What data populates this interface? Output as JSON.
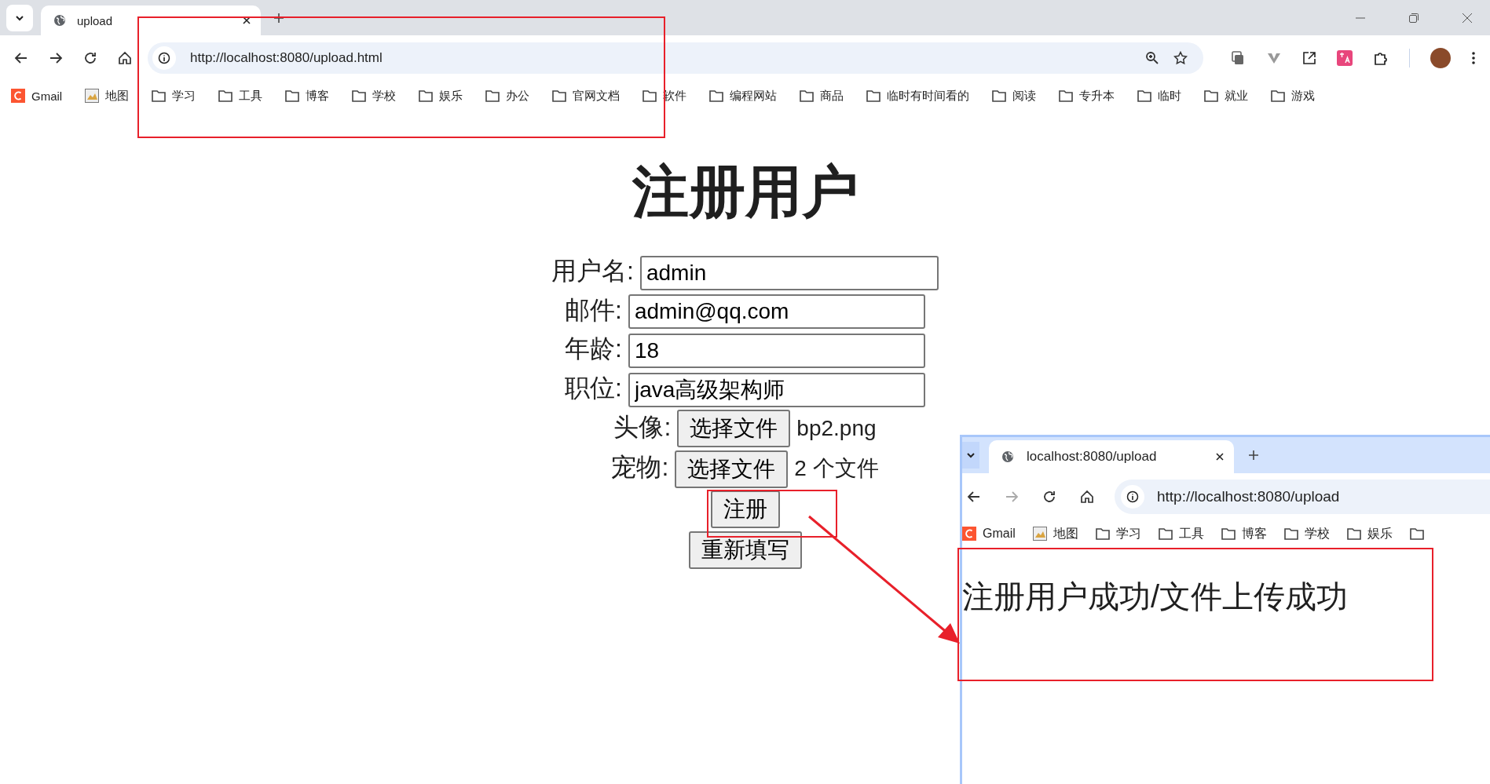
{
  "browser": {
    "tabs": [
      {
        "title": "upload",
        "selected": true
      }
    ],
    "url": "http://localhost:8080/upload.html",
    "forward_disabled": false,
    "bookmarks": [
      {
        "label": "Gmail",
        "kind": "gmail"
      },
      {
        "label": "地图",
        "kind": "maps"
      },
      {
        "label": "学习",
        "kind": "folder"
      },
      {
        "label": "工具",
        "kind": "folder"
      },
      {
        "label": "博客",
        "kind": "folder"
      },
      {
        "label": "学校",
        "kind": "folder"
      },
      {
        "label": "娱乐",
        "kind": "folder"
      },
      {
        "label": "办公",
        "kind": "folder"
      },
      {
        "label": "官网文档",
        "kind": "folder"
      },
      {
        "label": "软件",
        "kind": "folder"
      },
      {
        "label": "编程网站",
        "kind": "folder"
      },
      {
        "label": "商品",
        "kind": "folder"
      },
      {
        "label": "临时有时间看的",
        "kind": "folder"
      },
      {
        "label": "阅读",
        "kind": "folder"
      },
      {
        "label": "专升本",
        "kind": "folder"
      },
      {
        "label": "临时",
        "kind": "folder"
      },
      {
        "label": "就业",
        "kind": "folder"
      },
      {
        "label": "游戏",
        "kind": "folder"
      }
    ]
  },
  "page": {
    "title": "注册用户",
    "fields": [
      {
        "label": "用户名:",
        "value": "admin"
      },
      {
        "label": "邮件:",
        "value": "admin@qq.com"
      },
      {
        "label": "年龄:",
        "value": "18"
      },
      {
        "label": "职位:",
        "value": "java高级架构师"
      }
    ],
    "file_fields": [
      {
        "label": "头像:",
        "button": "选择文件",
        "status": "bp2.png"
      },
      {
        "label": "宠物:",
        "button": "选择文件",
        "status": "2 个文件"
      }
    ],
    "buttons": [
      "注册",
      "重新填写"
    ]
  },
  "result_window": {
    "tabs": [
      {
        "title": "localhost:8080/upload",
        "selected": true
      }
    ],
    "url": "http://localhost:8080/upload",
    "forward_disabled": true,
    "bookmarks": [
      {
        "label": "Gmail",
        "kind": "gmail"
      },
      {
        "label": "地图",
        "kind": "maps"
      },
      {
        "label": "学习",
        "kind": "folder"
      },
      {
        "label": "工具",
        "kind": "folder"
      },
      {
        "label": "博客",
        "kind": "folder"
      },
      {
        "label": "学校",
        "kind": "folder"
      },
      {
        "label": "娱乐",
        "kind": "folder"
      },
      {
        "kind": "folder"
      }
    ],
    "message": "注册用户成功/文件上传成功"
  }
}
